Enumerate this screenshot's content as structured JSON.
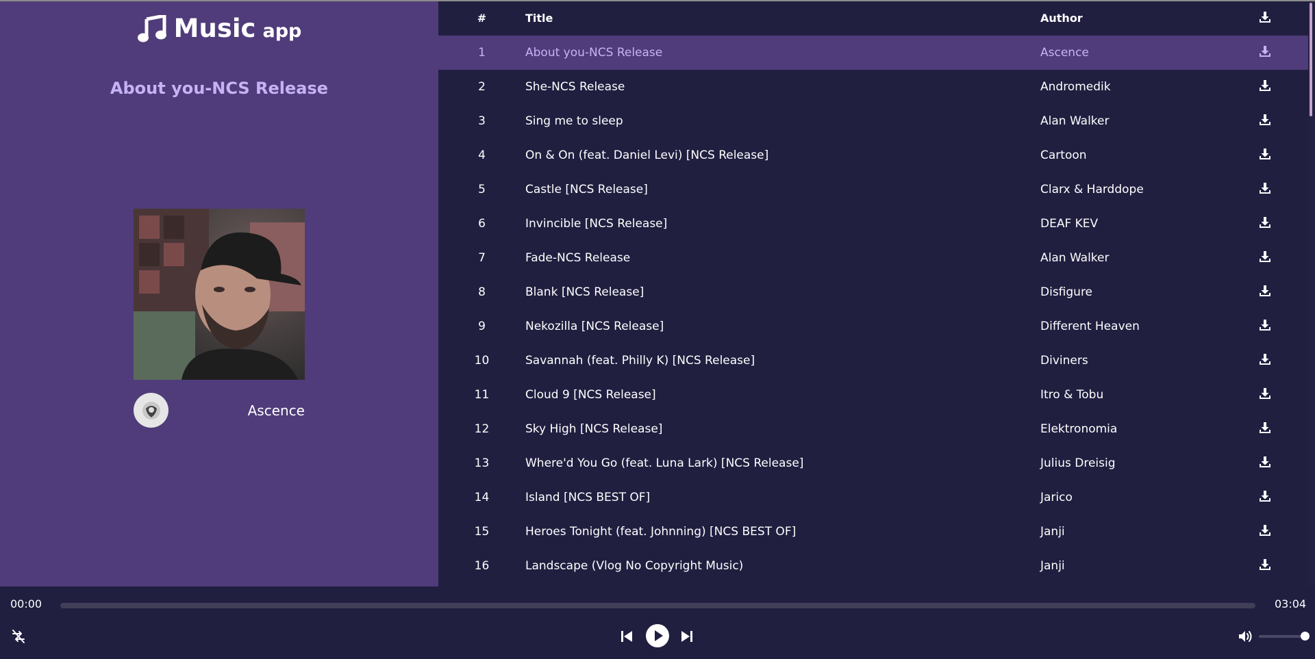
{
  "app": {
    "name": "Music",
    "name_suffix": "app"
  },
  "now_playing": {
    "title": "About you-NCS Release",
    "artist": "Ascence"
  },
  "table": {
    "headers": {
      "num": "#",
      "title": "Title",
      "author": "Author"
    },
    "rows": [
      {
        "num": "1",
        "title": "About you-NCS Release",
        "author": "Ascence",
        "active": true
      },
      {
        "num": "2",
        "title": "She-NCS Release",
        "author": "Andromedik"
      },
      {
        "num": "3",
        "title": "Sing me to sleep",
        "author": "Alan Walker"
      },
      {
        "num": "4",
        "title": "On & On (feat. Daniel Levi) [NCS Release]",
        "author": "Cartoon"
      },
      {
        "num": "5",
        "title": "Castle [NCS Release]",
        "author": "Clarx & Harddope"
      },
      {
        "num": "6",
        "title": "Invincible [NCS Release]",
        "author": "DEAF KEV"
      },
      {
        "num": "7",
        "title": "Fade-NCS Release",
        "author": "Alan Walker"
      },
      {
        "num": "8",
        "title": "Blank [NCS Release]",
        "author": "Disfigure"
      },
      {
        "num": "9",
        "title": "Nekozilla [NCS Release]",
        "author": "Different Heaven"
      },
      {
        "num": "10",
        "title": "Savannah (feat. Philly K) [NCS Release]",
        "author": "Diviners"
      },
      {
        "num": "11",
        "title": "Cloud 9 [NCS Release]",
        "author": "Itro & Tobu"
      },
      {
        "num": "12",
        "title": "Sky High [NCS Release]",
        "author": "Elektronomia"
      },
      {
        "num": "13",
        "title": "Where'd You Go (feat. Luna Lark) [NCS Release]",
        "author": "Julius Dreisig"
      },
      {
        "num": "14",
        "title": "Island [NCS BEST OF]",
        "author": "Jarico"
      },
      {
        "num": "15",
        "title": "Heroes Tonight (feat. Johnning) [NCS BEST OF]",
        "author": "Janji"
      },
      {
        "num": "16",
        "title": "Landscape (Vlog No Copyright Music)",
        "author": "Janji"
      }
    ]
  },
  "player": {
    "current_time": "00:00",
    "duration": "03:04",
    "progress": 0,
    "volume": 1.0,
    "controls": [
      "shuffle-off-icon",
      "previous-icon",
      "play-icon",
      "next-icon",
      "volume-icon"
    ]
  },
  "colors": {
    "sidebar_bg": "#503c7a",
    "main_bg": "#201f40",
    "accent": "#c6b3f5",
    "active_row_bg": "#503c7a",
    "scroll_thumb": "#c4a3c9"
  }
}
